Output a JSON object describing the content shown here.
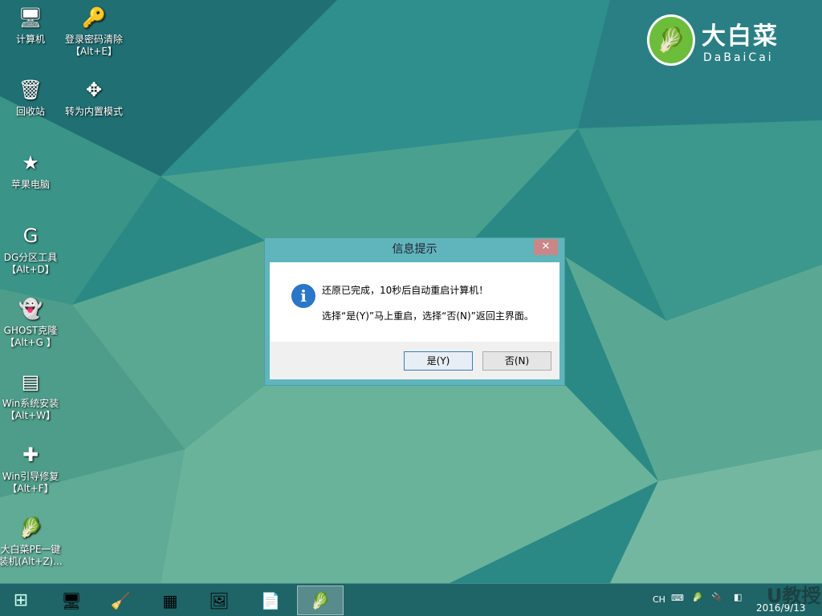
{
  "desktop": {
    "icons": [
      {
        "label": "计算机",
        "sub": "",
        "icon": "computer-icon",
        "glyph": "🖥"
      },
      {
        "label": "回收站",
        "sub": "",
        "icon": "recycle-bin-icon",
        "glyph": "🗑"
      },
      {
        "label": "苹果电脑",
        "sub": "",
        "icon": "star-icon",
        "glyph": "★"
      },
      {
        "label": "DG分区工具",
        "sub": "【Alt+D】",
        "icon": "diskgenius-icon",
        "glyph": "G"
      },
      {
        "label": "GHOST克隆",
        "sub": "【Alt+G 】",
        "icon": "ghost-icon",
        "glyph": "👻"
      },
      {
        "label": "Win系统安装",
        "sub": "【Alt+W】",
        "icon": "windows-install-icon",
        "glyph": "▤"
      },
      {
        "label": "Win引导修复",
        "sub": "【Alt+F】",
        "icon": "boot-repair-icon",
        "glyph": "✚"
      },
      {
        "label": "大白菜PE一键",
        "sub": "装机(Alt+Z)...",
        "icon": "dabaicai-icon",
        "glyph": "🥬"
      }
    ],
    "icons2": [
      {
        "label": "登录密码清除",
        "sub": "【Alt+E】",
        "icon": "nt-password-icon",
        "glyph": "🔑"
      },
      {
        "label": "转为内置模式",
        "sub": "",
        "icon": "internal-mode-icon",
        "glyph": "✥"
      }
    ],
    "logo": {
      "cn": "大白菜",
      "en": "DaBaiCai"
    }
  },
  "dialog": {
    "title": "信息提示",
    "close": "✕",
    "message1": "还原已完成，10秒后自动重启计算机！",
    "message2": "选择“是(Y)”马上重启，选择“否(N)”返回主界面。",
    "yes": "是(Y)",
    "no": "否(N)"
  },
  "taskbar": {
    "items": [
      "start",
      "desktop",
      "cleaner",
      "hardware",
      "imaging",
      "notepad",
      "dabaicai"
    ],
    "tray": {
      "lang": "CH",
      "date": "2016/9/13"
    }
  },
  "watermark": "U教授 UJIAOSHOU.COM"
}
